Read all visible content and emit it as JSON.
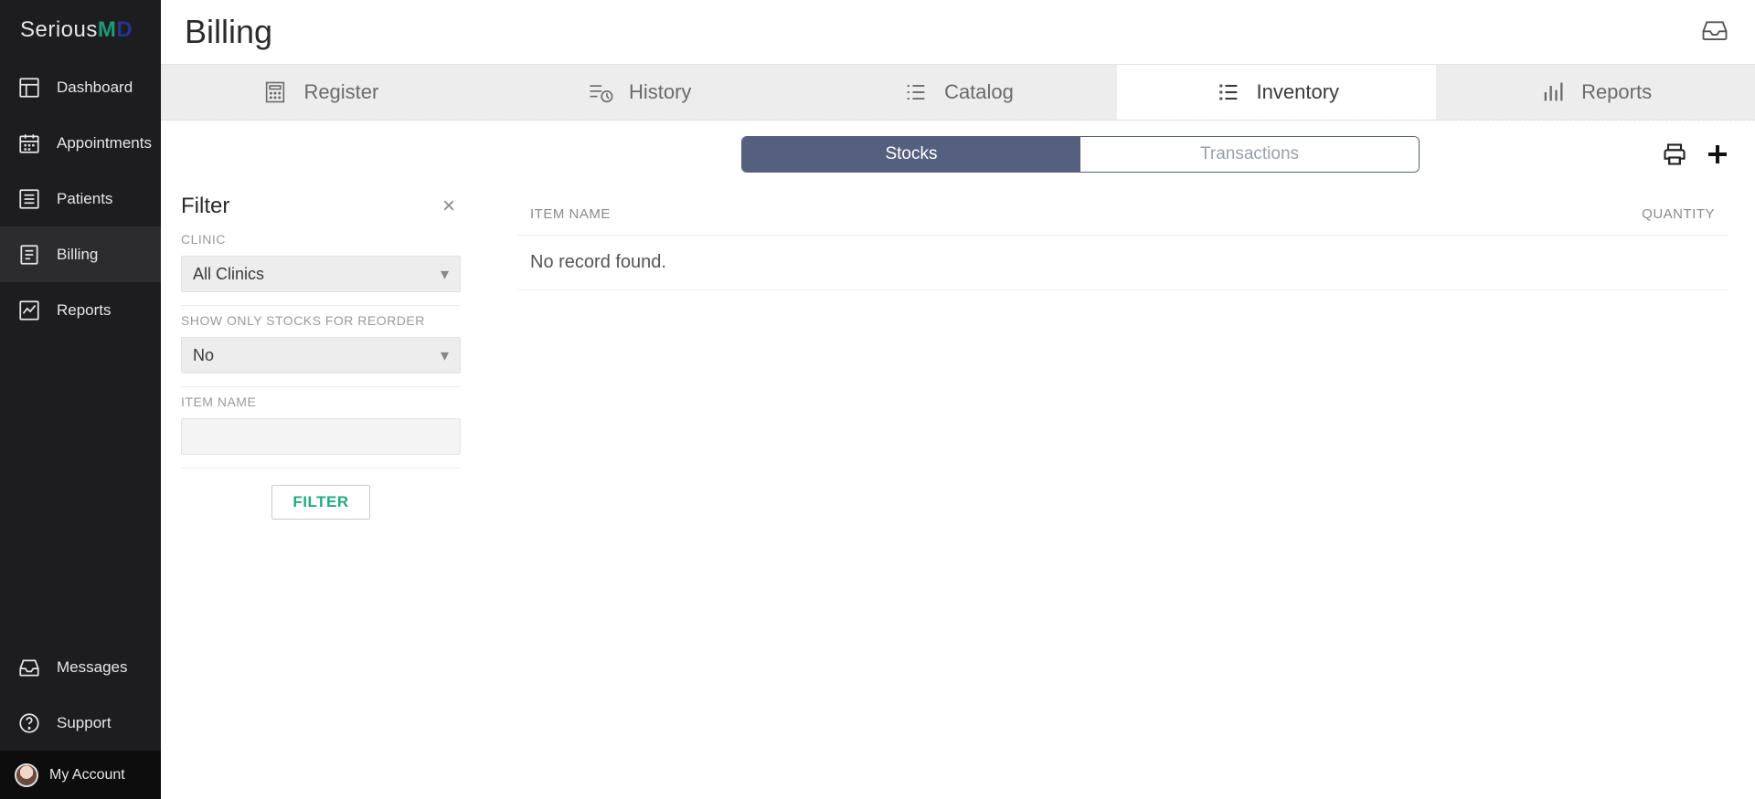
{
  "brand": {
    "text_a": "Serious",
    "text_m": "M",
    "text_d": "D"
  },
  "sidebar": {
    "items": [
      {
        "label": "Dashboard"
      },
      {
        "label": "Appointments"
      },
      {
        "label": "Patients"
      },
      {
        "label": "Billing"
      },
      {
        "label": "Reports"
      }
    ],
    "bottom": [
      {
        "label": "Messages"
      },
      {
        "label": "Support"
      }
    ],
    "account_label": "My Account"
  },
  "page": {
    "title": "Billing"
  },
  "subtabs": [
    {
      "label": "Register"
    },
    {
      "label": "History"
    },
    {
      "label": "Catalog"
    },
    {
      "label": "Inventory"
    },
    {
      "label": "Reports"
    }
  ],
  "segmented": [
    {
      "label": "Stocks"
    },
    {
      "label": "Transactions"
    }
  ],
  "filter": {
    "title": "Filter",
    "clinic_label": "CLINIC",
    "clinic_value": "All Clinics",
    "reorder_label": "SHOW ONLY STOCKS FOR REORDER",
    "reorder_value": "No",
    "item_name_label": "ITEM NAME",
    "item_name_value": "",
    "button": "FILTER"
  },
  "table": {
    "col_item": "ITEM NAME",
    "col_qty": "QUANTITY",
    "empty": "No record found."
  }
}
